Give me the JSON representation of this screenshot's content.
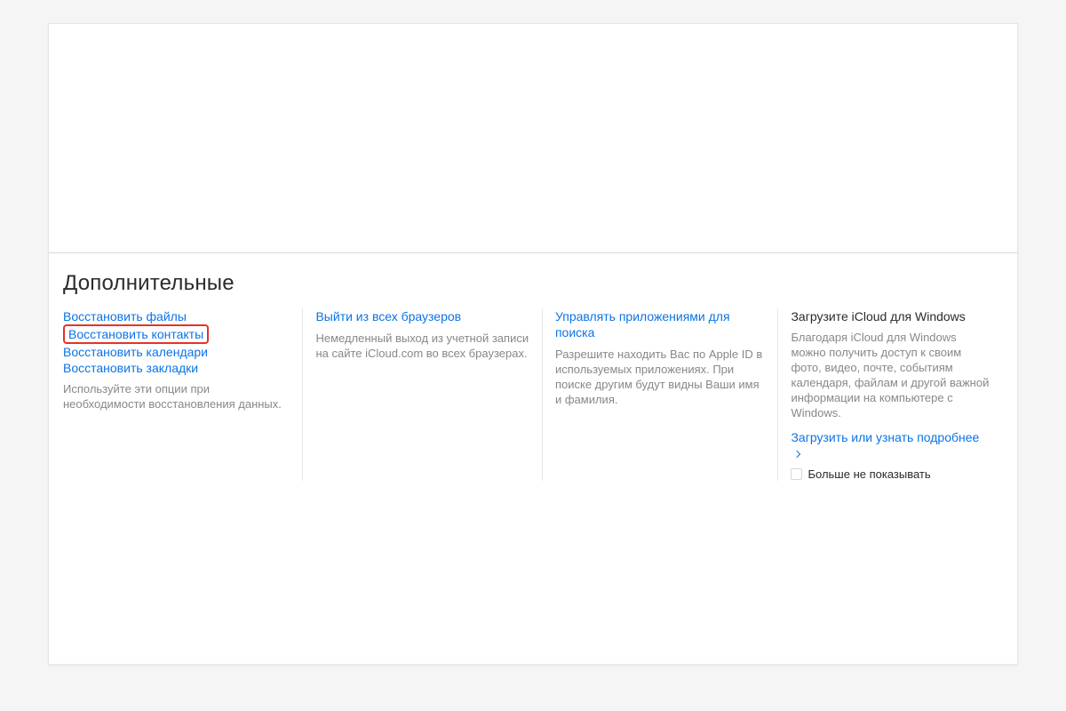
{
  "section": {
    "title": "Дополнительные"
  },
  "restore": {
    "files": "Восстановить файлы",
    "contacts": "Восстановить контакты",
    "calendars": "Восстановить календари",
    "bookmarks": "Восстановить закладки",
    "desc": "Используйте эти опции при необходимости восстановления данных."
  },
  "signout": {
    "title": "Выйти из всех браузеров",
    "desc": "Немедленный выход из учетной записи на сайте iCloud.com во всех браузерах."
  },
  "lookup": {
    "title": "Управлять приложениями для поиска",
    "desc": "Разрешите находить Вас по Apple ID в используемых приложениях. При поиске другим будут видны Ваши имя и фамилия."
  },
  "windows": {
    "title": "Загрузите iCloud для Windows",
    "desc": "Благодаря iCloud для Windows можно получить доступ к своим фото, видео, почте, событиям календаря, файлам и другой важной информации на компьютере с Windows.",
    "learn_more": "Загрузить или узнать подробнее",
    "dont_show": "Больше не показывать"
  }
}
